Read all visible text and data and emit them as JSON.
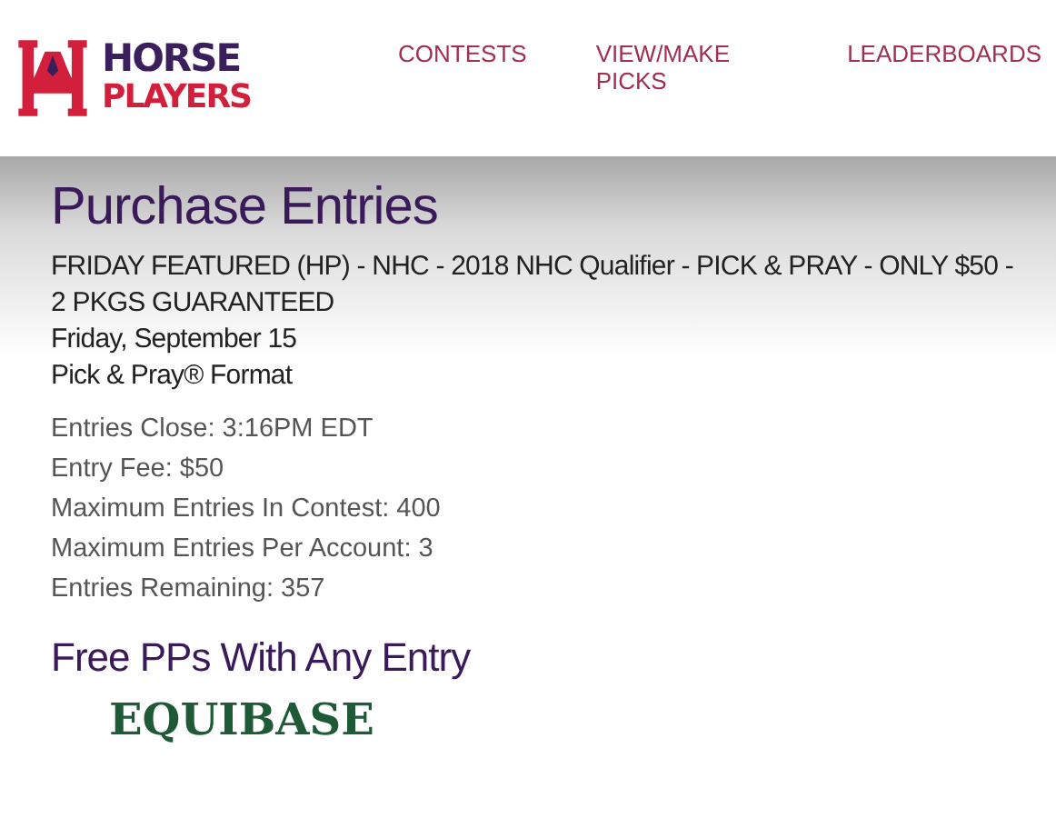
{
  "logo": {
    "line_1": "HORSE",
    "line_2": "PLAYERS"
  },
  "nav": [
    {
      "label": "CONTESTS"
    },
    {
      "label": "VIEW/MAKE PICKS"
    },
    {
      "label": "LEADERBOARDS"
    }
  ],
  "title": "Purchase Entries",
  "contest": {
    "name": "FRIDAY FEATURED (HP) - NHC - 2018 NHC Qualifier - PICK & PRAY - ONLY $50 - 2 PKGS GUARANTEED",
    "date": "Friday, September 15",
    "format": "Pick & Pray® Format"
  },
  "details": [
    "Entries Close: 3:16PM EDT",
    "Entry Fee: $50",
    "Maximum Entries In Contest: 400",
    "Maximum Entries Per Account: 3",
    "Entries Remaining: 357"
  ],
  "promo": {
    "heading": "Free PPs With Any Entry",
    "brand": "EQUIBASE"
  }
}
